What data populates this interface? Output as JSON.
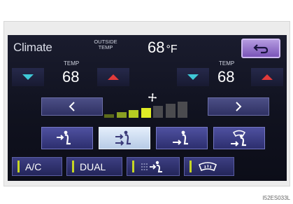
{
  "screen": {
    "title": "Climate",
    "outside": {
      "label": "OUTSIDE TEMP",
      "value": "68",
      "unit": "°F"
    },
    "back_icon": "return-arrow-icon"
  },
  "driver": {
    "temp_label": "TEMP",
    "temp_value": "68"
  },
  "passenger": {
    "temp_label": "TEMP",
    "temp_value": "68"
  },
  "fan": {
    "level": 4,
    "max_level": 7,
    "icon": "fan-icon",
    "active_colors": [
      "#5c6b1a",
      "#8aa022",
      "#b6cc22",
      "#e0ec26"
    ],
    "inactive_color": "#4b4b4f"
  },
  "airflow_modes": [
    {
      "name": "face",
      "icon": "airflow-face-icon",
      "active": false
    },
    {
      "name": "face-feet",
      "icon": "airflow-face-feet-icon",
      "active": true
    },
    {
      "name": "feet",
      "icon": "airflow-feet-icon",
      "active": false
    },
    {
      "name": "feet-defrost",
      "icon": "airflow-feet-defrost-icon",
      "active": false
    }
  ],
  "toggles": {
    "ac": "A/C",
    "dual": "DUAL",
    "recirculate_icon": "air-intake-icon",
    "defrost_icon": "windshield-defrost-icon"
  },
  "colors": {
    "accent_red": "#e23a3a",
    "accent_teal": "#3fc8d6",
    "indicator": "#c6d624"
  },
  "image_code": "I52ES033L"
}
